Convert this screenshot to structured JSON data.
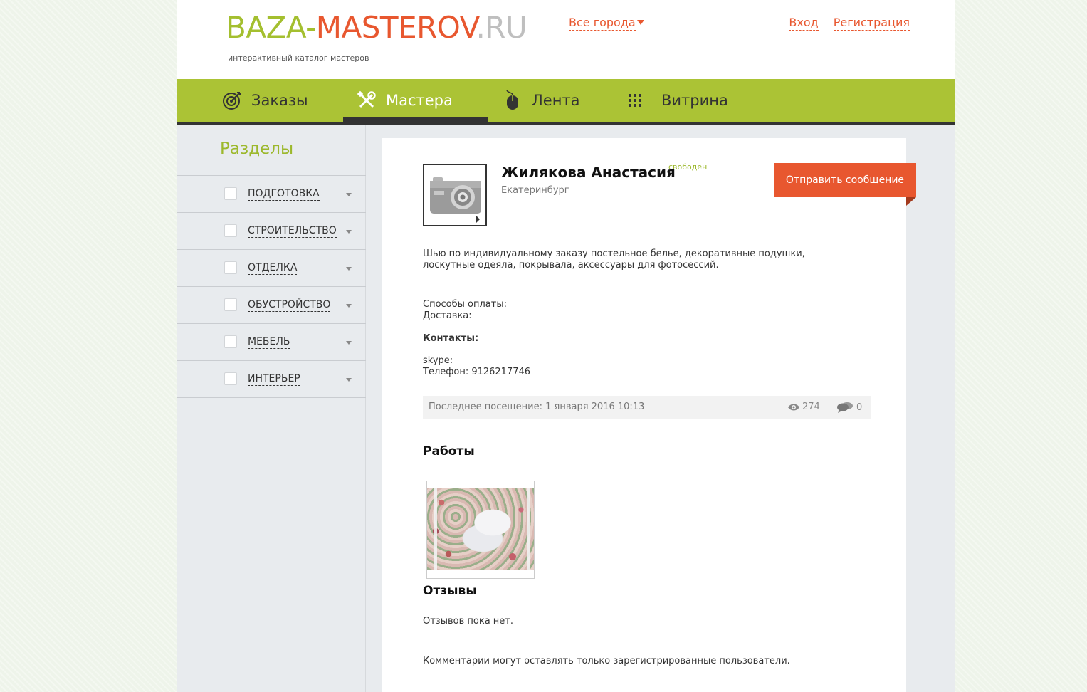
{
  "header": {
    "logo_part1": "BAZA-",
    "logo_part2": "MASTEROV",
    "logo_part3": ".RU",
    "tagline": "интерактивный каталог мастеров",
    "city_selector": "Все города",
    "login": "Вход",
    "register": "Регистрация"
  },
  "nav": {
    "items": [
      {
        "label": "Заказы",
        "icon": "target-icon"
      },
      {
        "label": "Мастера",
        "icon": "tools-icon"
      },
      {
        "label": "Лента",
        "icon": "mouse-icon"
      },
      {
        "label": "Витрина",
        "icon": "grid-icon"
      }
    ],
    "active": "Мастера"
  },
  "sidebar": {
    "title": "Разделы",
    "sections": [
      {
        "label": "ПОДГОТОВКА"
      },
      {
        "label": "СТРОИТЕЛЬСТВО"
      },
      {
        "label": "ОТДЕЛКА"
      },
      {
        "label": "ОБУСТРОЙСТВО"
      },
      {
        "label": "МЕБЕЛЬ"
      },
      {
        "label": "ИНТЕРЬЕР"
      }
    ]
  },
  "profile": {
    "name": "Жилякова Анастасия",
    "status": "свободен",
    "city": "Екатеринбург",
    "send_message": "Отправить сообщение",
    "description": "Шью по индивидуальному заказу постельное белье, декоративные подушки, лоскутные одеяла, покрывала, аксессуары для фотосессий.",
    "payment_label": "Способы оплаты:",
    "delivery_label": "Доставка:",
    "contacts_label": "Контакты:",
    "skype_label": "skype:",
    "phone": "Телефон: 9126217746",
    "last_visit": "Последнее посещение: 1 января 2016 10:13",
    "views": "274",
    "comments": "0"
  },
  "works": {
    "title": "Работы"
  },
  "reviews": {
    "title": "Отзывы",
    "empty": "Отзывов пока нет.",
    "note": "Комментарии могут оставлять только зарегистрированные пользователи."
  },
  "colors": {
    "brand_green": "#abc335",
    "accent_orange": "#e8572f",
    "nav_dark": "#333333"
  }
}
